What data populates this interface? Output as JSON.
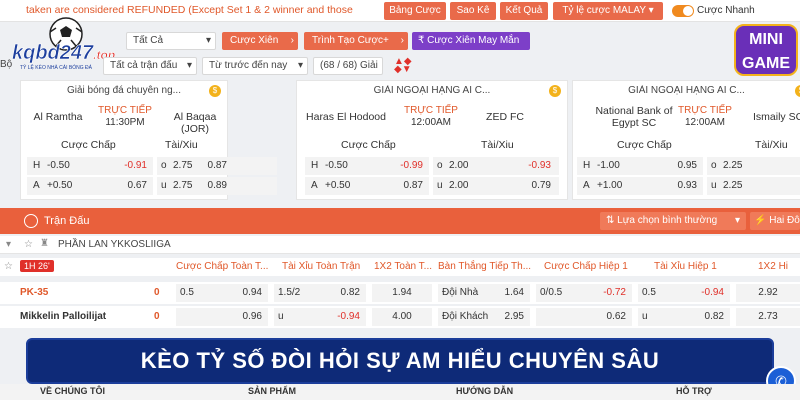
{
  "topbar": {
    "notice": "taken are considered REFUNDED (Except Set 1 & 2 winner and those",
    "buttons": [
      "Bảng Cược",
      "Sao Kê",
      "Kết Quả",
      "Tỷ lệ cược MALAY"
    ],
    "toggle_label": "Cược Nhanh"
  },
  "logo": {
    "text": "kqbd247",
    "suffix": ".top",
    "tagline": "TỶ LỆ KÈO NHÀ CÁI BÓNG ĐÁ"
  },
  "minigame": {
    "text": "MINI GAME"
  },
  "filters": {
    "sport": "Tất Cả",
    "parlay_button": "Cược Xiên",
    "create_bet_button": "Trình Tạo Cược+",
    "lucky_parlay_button": "Cược Xiên May Mắn",
    "match_filter": "Tất cả trận đấu",
    "sort": "Từ trước đến nay",
    "league_count": "(68 / 68) Giải",
    "partial_label": "Bộ"
  },
  "cards": [
    {
      "league": "Giải bóng đá chuyên ng...",
      "home": "Al Ramtha",
      "away": "Al Baqaa (JOR)",
      "status": "TRỰC TIẾP",
      "time": "11:30PM",
      "handicap_header": "Cược Chấp",
      "ou_header": "Tài/Xiu",
      "rows": [
        {
          "h_label": "H",
          "h_line": "-0.50",
          "h_odds": "-0.91",
          "ou_label": "o",
          "ou_line": "2.75",
          "ou_odds": "0.87"
        },
        {
          "h_label": "A",
          "h_line": "+0.50",
          "h_odds": "0.67",
          "ou_label": "u",
          "ou_line": "2.75",
          "ou_odds": "0.89"
        }
      ]
    },
    {
      "league": "GIẢI NGOẠI HẠNG AI C...",
      "home": "Haras El Hodood",
      "away": "ZED FC",
      "status": "TRỰC TIẾP",
      "time": "12:00AM",
      "handicap_header": "Cược Chấp",
      "ou_header": "Tài/Xiu",
      "rows": [
        {
          "h_label": "H",
          "h_line": "-0.50",
          "h_odds": "-0.99",
          "ou_label": "o",
          "ou_line": "2.00",
          "ou_odds": "-0.93"
        },
        {
          "h_label": "A",
          "h_line": "+0.50",
          "h_odds": "0.87",
          "ou_label": "u",
          "ou_line": "2.00",
          "ou_odds": "0.79"
        }
      ]
    },
    {
      "league": "GIẢI NGOẠI HẠNG AI C...",
      "home": "National Bank of Egypt SC",
      "away": "Ismaily SC",
      "status": "TRỰC TIẾP",
      "time": "12:00AM",
      "handicap_header": "Cược Chấp",
      "ou_header": "Tài/Xiu",
      "rows": [
        {
          "h_label": "H",
          "h_line": "-1.00",
          "h_odds": "0.95",
          "ou_label": "o",
          "ou_line": "2.25",
          "ou_odds": ""
        },
        {
          "h_label": "A",
          "h_line": "+1.00",
          "h_odds": "0.93",
          "ou_label": "u",
          "ou_line": "2.25",
          "ou_odds": ""
        }
      ]
    }
  ],
  "matches_bar": {
    "title": "Trận Đấu",
    "sort_select": "Lựa chọn bình thường",
    "doubles_button": "Hai Đô"
  },
  "league": {
    "name": "PHẦN LAN YKKOSLIIGA"
  },
  "table": {
    "live_time": "1H 26'",
    "headers": [
      "Cược Chấp Toàn T...",
      "Tài Xỉu Toàn Trận",
      "1X2 Toàn T...",
      "Bàn Thắng Tiếp Th...",
      "Cược Chấp Hiệp 1",
      "Tài Xỉu Hiệp 1",
      "1X2 Hi"
    ],
    "rows": [
      {
        "team": "PK-35",
        "score": "0",
        "hc_line": "0.5",
        "hc_odds": "0.94",
        "ou_line": "1.5/2",
        "ou_odds": "0.82",
        "x12": "1.94",
        "next_label": "Đội Nhà",
        "next_odds": "1.64",
        "h1_line": "0/0.5",
        "h1_odds": "-0.72",
        "h1ou_line": "0.5",
        "h1ou_odds": "-0.94",
        "h1x12": "2.92"
      },
      {
        "team": "Mikkelin Palloilijat",
        "score": "0",
        "hc_line": "",
        "hc_odds": "0.96",
        "ou_line": "u",
        "ou_odds": "-0.94",
        "x12": "4.00",
        "next_label": "Đội Khách",
        "next_odds": "2.95",
        "h1_line": "",
        "h1_odds": "0.62",
        "h1ou_line": "u",
        "h1ou_odds": "0.82",
        "h1x12": "2.73"
      }
    ]
  },
  "banner": {
    "text": "KÈO TỶ SỐ ĐÒI HỎI SỰ AM HIỂU CHUYÊN SÂU"
  },
  "footer": {
    "items": [
      "VỀ CHÚNG TÔI",
      "SẢN PHẨM",
      "HƯỚNG DẪN",
      "HỖ TRỢ"
    ]
  },
  "colors": {
    "accent": "#e9603c",
    "live": "#e0582a",
    "negative": "#e0302a",
    "banner": "#0e2a78",
    "purple": "#7d3fc8"
  }
}
